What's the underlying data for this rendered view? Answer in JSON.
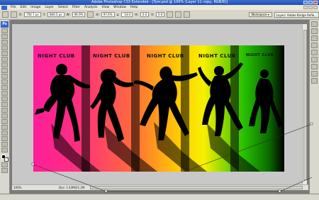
{
  "window": {
    "title": "Adobe Photoshop CS3 Extended - [Tyer.psd @ 100% (Layer 11 copy, RGB/8)]"
  },
  "menu": {
    "items": [
      "File",
      "Edit",
      "Image",
      "Layer",
      "Select",
      "Filter",
      "Analysis",
      "View",
      "Window",
      "Help"
    ]
  },
  "options": {
    "x_label": "X:",
    "x_value": "756.7 px",
    "y_label": "Y:",
    "y_value": "866.5 px",
    "w_label": "W:",
    "w_value": "96.9%",
    "h_label": "H:",
    "h_value": "97.6%",
    "angle_label": "∡",
    "angle_value": "-18.0",
    "hskew_label": "H:",
    "hskew_value": "0.0",
    "vskew_label": "V:",
    "vskew_value": "0.0",
    "workspace": "Workspace ▾",
    "layers_tab": "Layers",
    "layers_tab_extra": "Adobe Bridge Refle..."
  },
  "document": {
    "zoom": "100%",
    "doc_info": "Doc: 1.43M/21.2M"
  },
  "artwork": {
    "labels": [
      "NIGHT CLUB",
      "NIGHT CLUB",
      "NIGHT CLUB",
      "NIGHT CLUB",
      "NIGHT CLUB"
    ]
  },
  "colors": {
    "titlebar": "#2a5bc0",
    "app_bg": "#7b7b7b",
    "panel_bg": "#d9d8cf"
  },
  "icons": {
    "tools": [
      "move-tool-icon",
      "marquee-tool-icon",
      "lasso-tool-icon",
      "magic-wand-icon",
      "crop-tool-icon",
      "slice-tool-icon",
      "healing-brush-icon",
      "brush-tool-icon",
      "clone-stamp-icon",
      "history-brush-icon",
      "eraser-icon",
      "gradient-icon",
      "blur-icon",
      "dodge-icon",
      "pen-tool-icon",
      "type-tool-icon",
      "path-select-icon",
      "shape-tool-icon",
      "notes-icon",
      "eyedropper-icon",
      "hand-tool-icon",
      "zoom-tool-icon"
    ]
  }
}
